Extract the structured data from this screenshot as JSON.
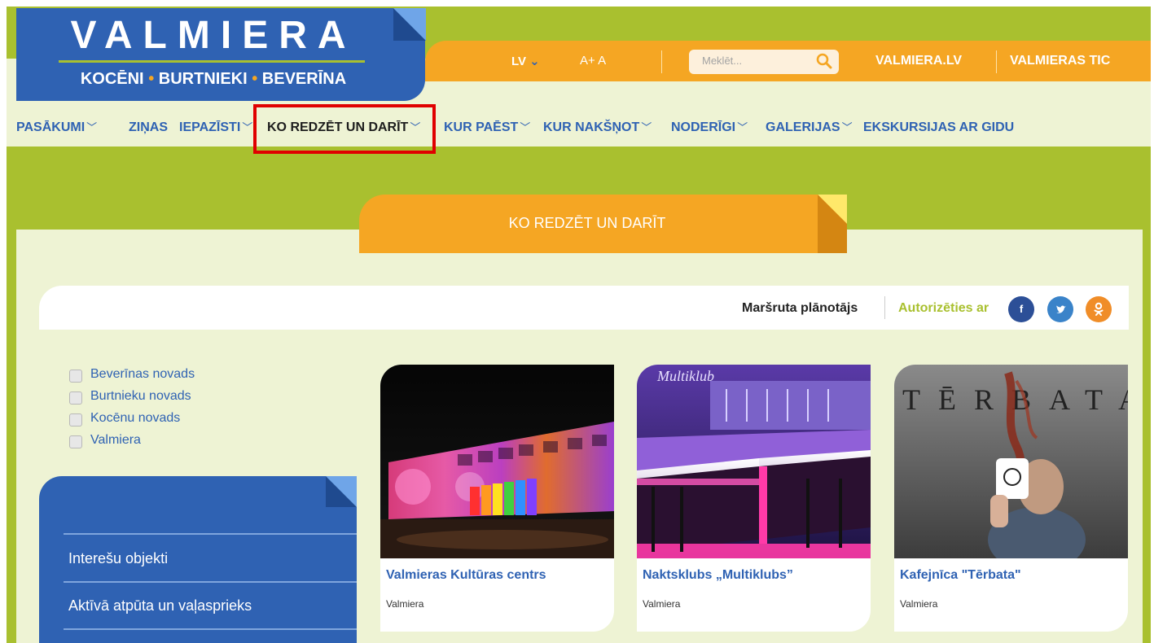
{
  "logo": {
    "title": "VALMIERA",
    "sub_1": "KOCĒNI",
    "sub_2": "BURTNIEKI",
    "sub_3": "BEVERĪNA",
    "sub_sep": "•"
  },
  "topbar": {
    "lang": "LV",
    "font_size_controls": "A+ A",
    "search_placeholder": "Meklēt...",
    "link_valmiera": "VALMIERA.LV",
    "link_tic": "VALMIERAS TIC"
  },
  "nav": {
    "items": [
      {
        "label": "PASĀKUMI",
        "dropdown": true
      },
      {
        "label": "ZIŅAS",
        "dropdown": false
      },
      {
        "label": "IEPAZĪSTI",
        "dropdown": true
      },
      {
        "label": "KO REDZĒT UN DARĪT",
        "dropdown": true,
        "active": true
      },
      {
        "label": "KUR PAĒST",
        "dropdown": true
      },
      {
        "label": "KUR NAKŠŅOT",
        "dropdown": true
      },
      {
        "label": "NODERĪGI",
        "dropdown": true
      },
      {
        "label": "GALERIJAS",
        "dropdown": true
      },
      {
        "label": "EKSKURSIJAS AR GIDU",
        "dropdown": false
      }
    ]
  },
  "section": {
    "title": "KO REDZĒT UN DARĪT"
  },
  "route_bar": {
    "planner_label": "Maršruta plānotājs",
    "auth_label": "Autorizēties ar",
    "social_icons": [
      "facebook-icon",
      "twitter-icon",
      "odnoklassniki-icon"
    ]
  },
  "filters": {
    "items": [
      {
        "label": "Beverīnas novads",
        "checked": false
      },
      {
        "label": "Burtnieku novads",
        "checked": false
      },
      {
        "label": "Kocēnu novads",
        "checked": false
      },
      {
        "label": "Valmiera",
        "checked": false
      }
    ]
  },
  "categories": {
    "items": [
      {
        "label": "Interešu objekti"
      },
      {
        "label": "Aktīvā atpūta un vaļasprieks"
      }
    ]
  },
  "cards": [
    {
      "title": "Valmieras Kultūras centrs",
      "location": "Valmiera"
    },
    {
      "title": "Naktsklubs „Multiklubs”",
      "location": "Valmiera"
    },
    {
      "title": "Kafejnīca \"Tērbata\"",
      "location": "Valmiera"
    }
  ],
  "colors": {
    "brand_blue": "#2f62b3",
    "brand_green": "#a9c02f",
    "brand_orange": "#f5a623",
    "cream": "#eef3d4",
    "highlight_red": "#e00000"
  }
}
